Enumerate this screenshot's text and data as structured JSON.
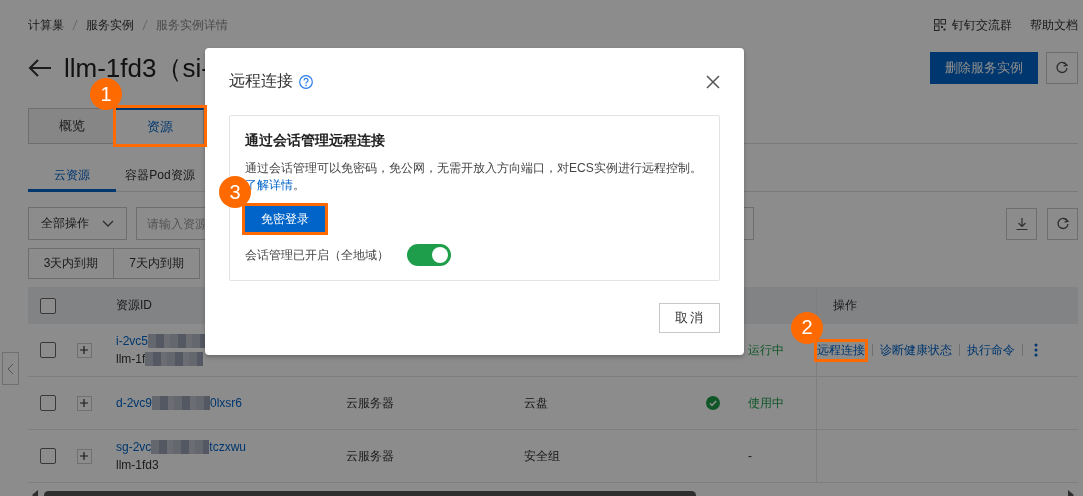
{
  "breadcrumb": [
    {
      "label": "计算巢"
    },
    {
      "label": "服务实例"
    },
    {
      "label": "服务实例详情"
    }
  ],
  "header_links": [
    {
      "label": "钉钉交流群",
      "kind": "qr"
    },
    {
      "label": "帮助文档",
      "kind": "plain"
    }
  ],
  "page_title": "llm-1fd3（si-",
  "delete_button": "删除服务实例",
  "tabs": [
    {
      "label": "概览",
      "selected": false
    },
    {
      "label": "资源",
      "selected": true,
      "marker": "1"
    }
  ],
  "subtabs": [
    {
      "label": "云资源",
      "selected": true
    },
    {
      "label": "容器Pod资源",
      "selected": false
    }
  ],
  "toolbar": {
    "bulk_action": "全部操作",
    "search": {
      "placeholder": "请输入资源"
    }
  },
  "filters": [
    {
      "label": "3天内到期"
    },
    {
      "label": "7天内到期"
    }
  ],
  "table": {
    "header_checked": false,
    "columns": [
      {
        "kind": "id",
        "label": "资源ID"
      },
      {
        "kind": "actions",
        "label": "操作"
      }
    ],
    "rows": [
      {
        "checked": false,
        "id": {
          "text": "i-2vc5",
          "redacted": true
        },
        "name": {
          "text": "llm-1f",
          "redacted": true
        },
        "status": {
          "text": "运行中",
          "kind": "success"
        },
        "actions": [
          {
            "label": "远程连接",
            "marker": "2"
          },
          {
            "label": "诊断健康状态"
          },
          {
            "label": "执行命令"
          }
        ],
        "more": true
      },
      {
        "checked": false,
        "id": {
          "text": "d-2vc9",
          "redacted": true,
          "rest": "0lxsr6"
        },
        "type": "云服务器",
        "category": "云盘",
        "status": {
          "text": "使用中",
          "kind": "success",
          "icon": true
        }
      },
      {
        "checked": false,
        "id": {
          "text": "sg-2vc",
          "redacted": true,
          "rest": "tczxwu"
        },
        "name": {
          "text": "llm-1fd3"
        },
        "type": "云服务器",
        "category": "安全组",
        "status": {
          "text": "-",
          "kind": "plain"
        }
      }
    ]
  },
  "modal": {
    "title": "远程连接",
    "card": {
      "heading": "通过会话管理远程连接",
      "description": {
        "text": "通过会话管理可以免密码，免公网，无需开放入方向端口，对ECS实例进行远程控制。",
        "link": "了解详情",
        "after": "。"
      },
      "login_button": {
        "label": "免密登录",
        "marker": "3"
      },
      "session_switch": {
        "label": "会话管理已开启（全地域）",
        "on": true
      }
    },
    "cancel_button": "取消"
  }
}
